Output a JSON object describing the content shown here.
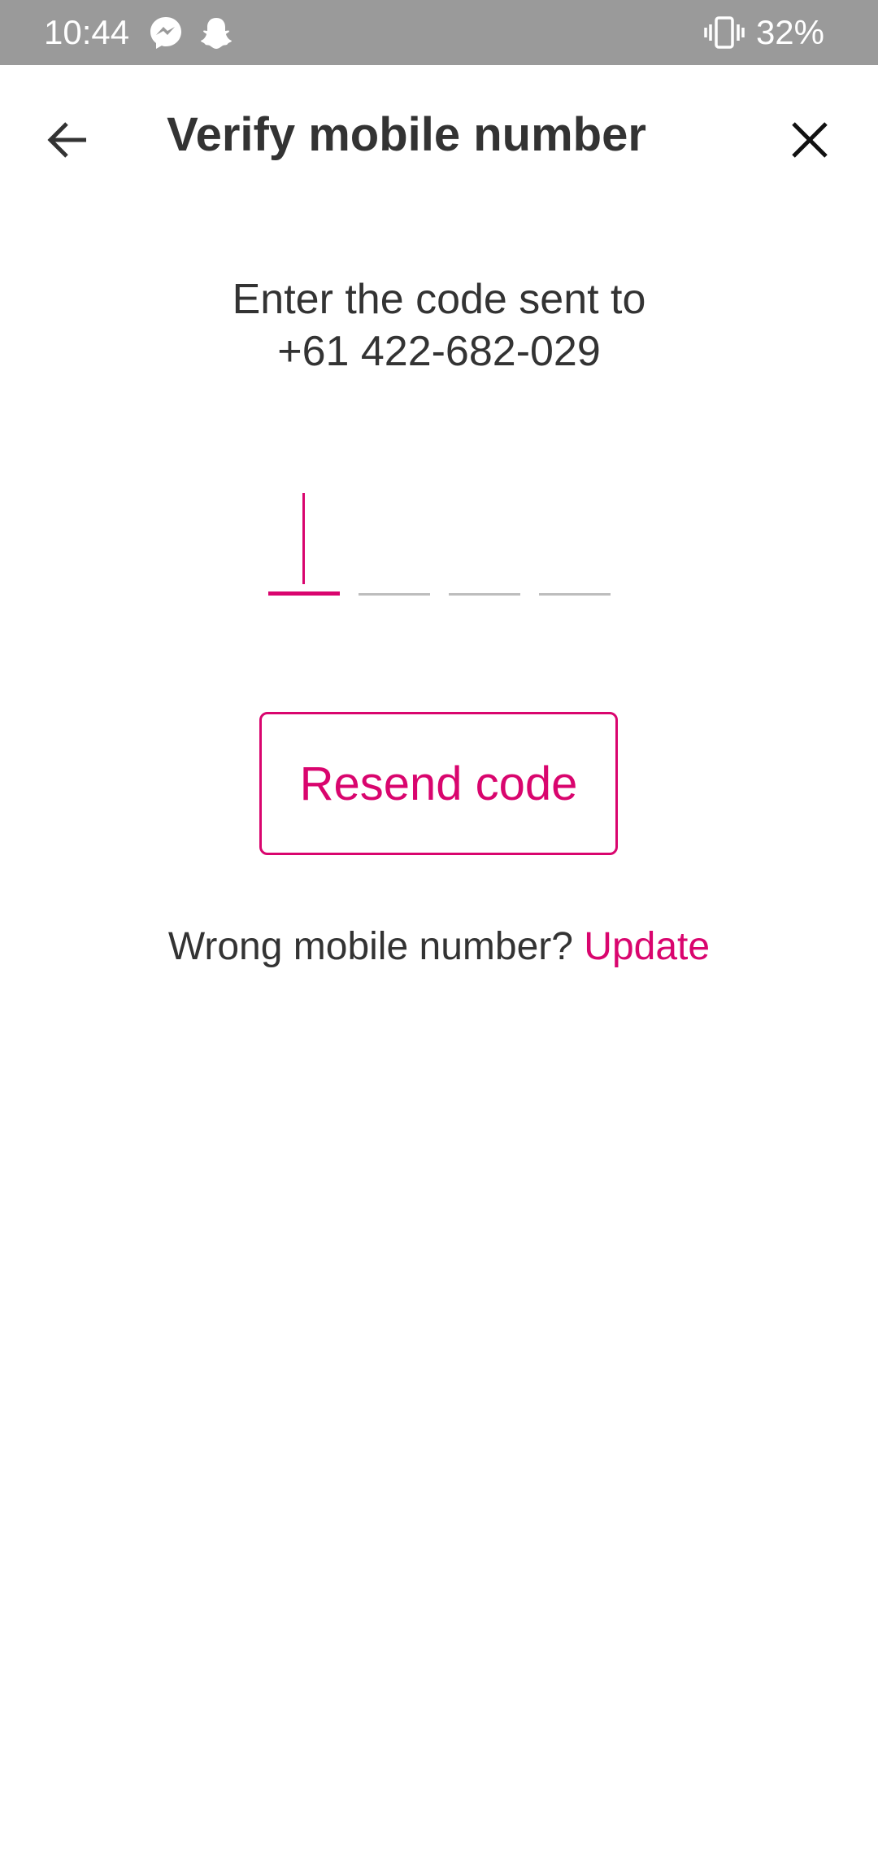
{
  "status_bar": {
    "time": "10:44",
    "notification_icons": [
      "messenger-icon",
      "snapchat-icon"
    ],
    "vibrate_icon": "vibrate-icon",
    "battery": "32%"
  },
  "header": {
    "title": "Verify mobile number",
    "back_icon": "arrow-left-icon",
    "close_icon": "close-icon"
  },
  "instruction": {
    "line1": "Enter the code sent to",
    "phone": "+61 422-682-029"
  },
  "code_input": {
    "length": 4,
    "values": [
      "",
      "",
      "",
      ""
    ],
    "active_index": 0
  },
  "resend": {
    "label": "Resend code"
  },
  "wrong_number": {
    "prompt": "Wrong mobile number?",
    "link": "Update"
  },
  "colors": {
    "accent": "#d9056e",
    "status_bar": "#9a9a9a",
    "text": "#333333",
    "inactive_underline": "#bdbdbd"
  }
}
